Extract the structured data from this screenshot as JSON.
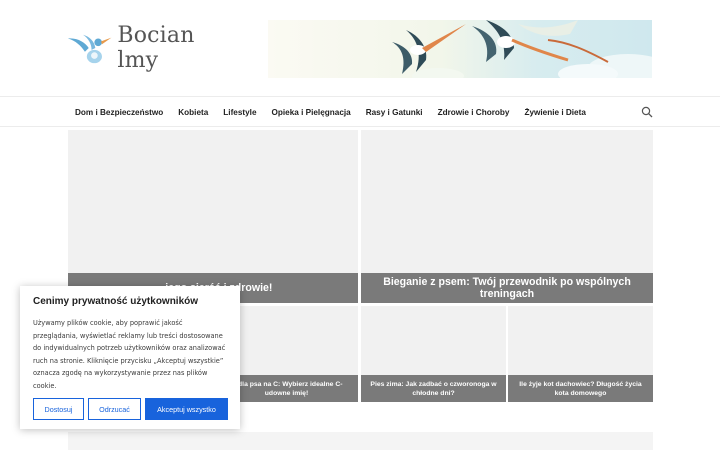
{
  "site": {
    "logo_text": "Bocian lmy"
  },
  "nav": {
    "items": [
      "Dom i Bezpieczeństwo",
      "Kobieta",
      "Lifestyle",
      "Opieka i Pielęgnacja",
      "Rasy i Gatunki",
      "Zdrowie i Choroby",
      "Żywienie i Dieta"
    ],
    "search_icon": "search-icon"
  },
  "posts": {
    "featured_1": "... jego sierść i zdrowie!",
    "featured_2": "Bieganie z psem: Twój przewodnik po wspólnych treningach",
    "small_2": "... dla psa na C: Wybierz idealne C-udowne imię!",
    "small_3": "Pies zima: Jak zadbać o czworonoga w chłodne dni?",
    "small_4": "Ile żyje kot dachowiec? Długość życia kota domowego"
  },
  "cookie": {
    "title": "Cenimy prywatność użytkowników",
    "text": "Używamy plików cookie, aby poprawić jakość przeglądania, wyświetlać reklamy lub treści dostosowane do indywidualnych potrzeb użytkowników oraz analizować ruch na stronie. Kliknięcie przycisku „Akceptuj wszystkie” oznacza zgodę na wykorzystywanie przez nas plików cookie.",
    "customize": "Dostosuj",
    "reject": "Odrzucać",
    "accept": "Akceptuj wszystko"
  },
  "colors": {
    "accent": "#1863dc",
    "title_overlay": "#7a7a7a",
    "logo_blue": "#5fa9d4"
  }
}
